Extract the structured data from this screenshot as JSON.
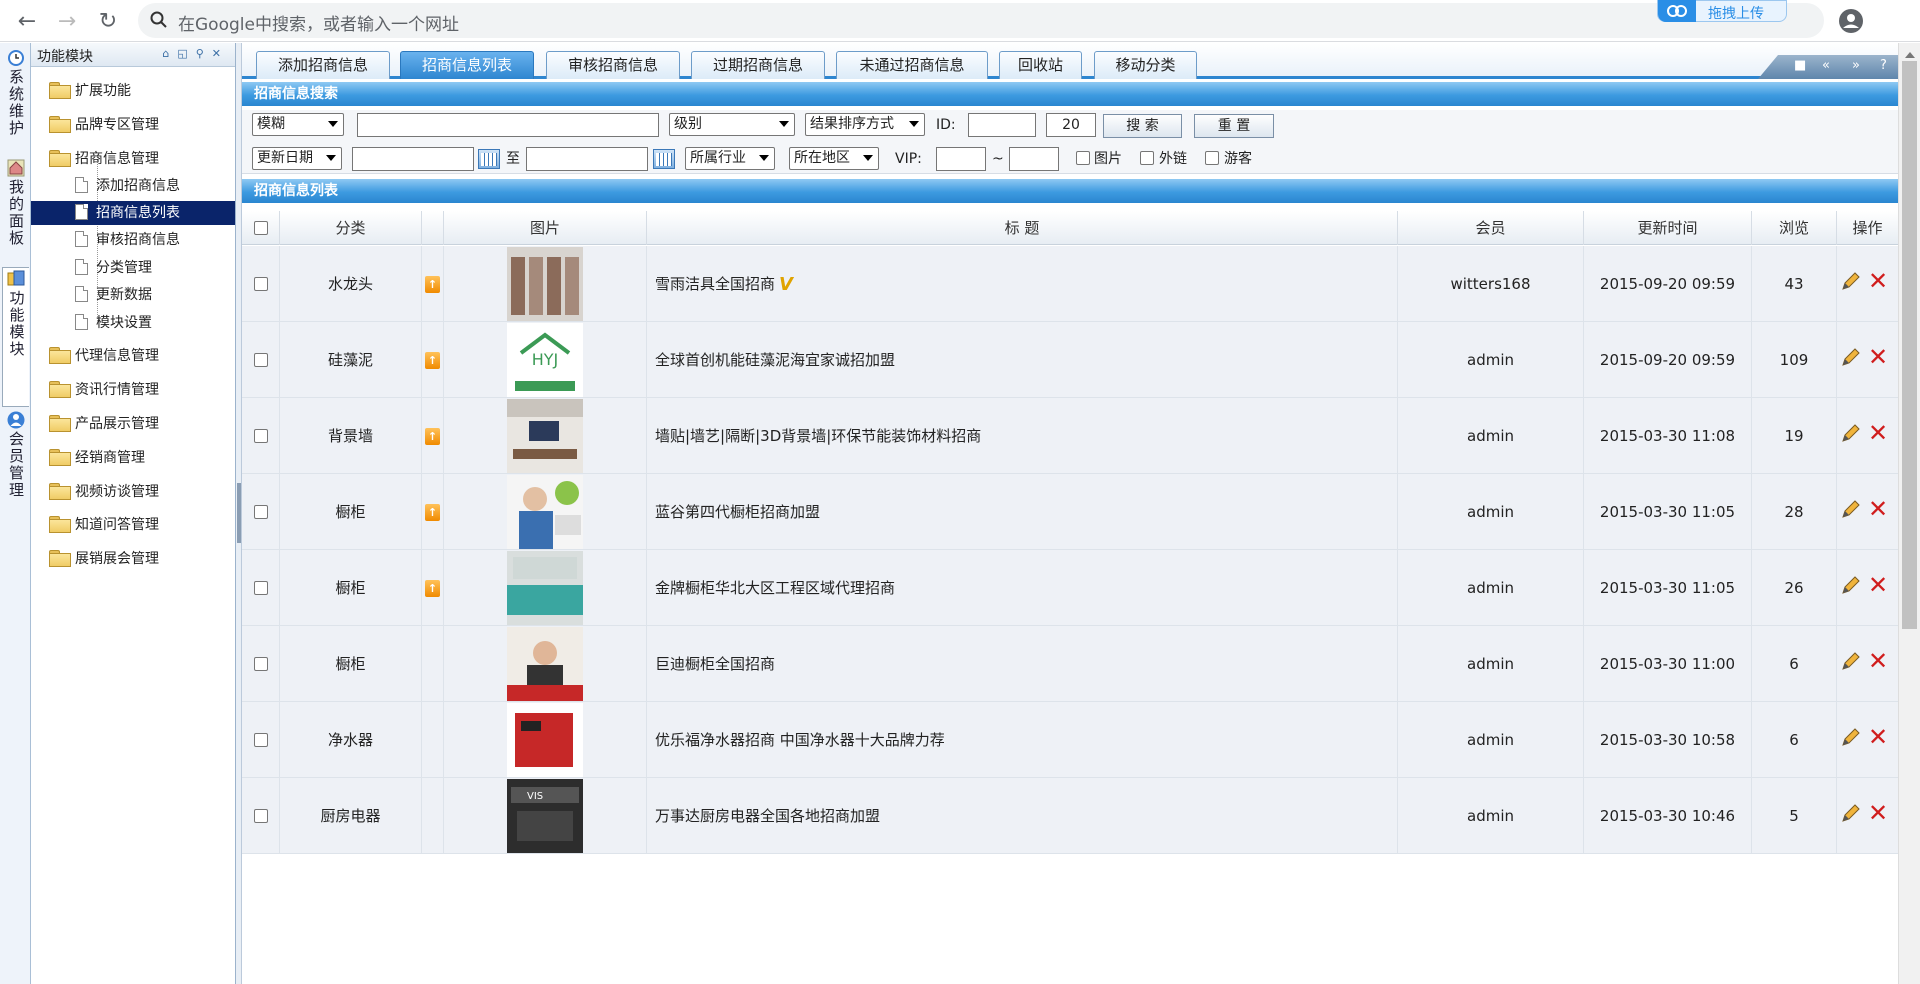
{
  "browser": {
    "omnibox_placeholder": "在Google中搜索，或者输入一个网址",
    "upload_label": "拖拽上传"
  },
  "vtabs": [
    {
      "label": "系统维护",
      "icon": "clock-icon"
    },
    {
      "label": "我的面板",
      "icon": "home-icon"
    },
    {
      "label": "功能模块",
      "icon": "module-icon"
    },
    {
      "label": "会员管理",
      "icon": "user-icon"
    }
  ],
  "tree": {
    "title": "功能模块",
    "items": [
      {
        "label": "扩展功能",
        "type": "folder"
      },
      {
        "label": "品牌专区管理",
        "type": "folder"
      },
      {
        "label": "招商信息管理",
        "type": "folder"
      },
      {
        "label": "添加招商信息",
        "type": "doc"
      },
      {
        "label": "招商信息列表",
        "type": "doc",
        "selected": true
      },
      {
        "label": "审核招商信息",
        "type": "doc"
      },
      {
        "label": "分类管理",
        "type": "doc"
      },
      {
        "label": "更新数据",
        "type": "doc"
      },
      {
        "label": "模块设置",
        "type": "doc"
      },
      {
        "label": "代理信息管理",
        "type": "folder"
      },
      {
        "label": "资讯行情管理",
        "type": "folder"
      },
      {
        "label": "产品展示管理",
        "type": "folder"
      },
      {
        "label": "经销商管理",
        "type": "folder"
      },
      {
        "label": "视频访谈管理",
        "type": "folder"
      },
      {
        "label": "知道问答管理",
        "type": "folder"
      },
      {
        "label": "展销展会管理",
        "type": "folder"
      }
    ]
  },
  "tabs": [
    {
      "label": "添加招商信息"
    },
    {
      "label": "招商信息列表",
      "active": true
    },
    {
      "label": "审核招商信息"
    },
    {
      "label": "过期招商信息"
    },
    {
      "label": "未通过招商信息"
    },
    {
      "label": "回收站"
    },
    {
      "label": "移动分类"
    }
  ],
  "search": {
    "section_title": "招商信息搜索",
    "match_mode": "模糊",
    "keyword": "",
    "level": "级别",
    "order": "结果排序方式",
    "id_label": "ID:",
    "id_value": "",
    "page_size": "20",
    "search_btn": "搜 索",
    "reset_btn": "重 置",
    "date_field": "更新日期",
    "date_from": "",
    "to_label": "至",
    "date_to": "",
    "industry": "所属行业",
    "region": "所在地区",
    "vip_label": "VIP:",
    "vip_from": "",
    "tilde": "~",
    "vip_to": "",
    "opt_image": "图片",
    "opt_link": "外链",
    "opt_guest": "游客"
  },
  "list": {
    "section_title": "招商信息列表",
    "columns": [
      "分类",
      "图片",
      "标 题",
      "会员",
      "更新时间",
      "浏览",
      "操作"
    ],
    "rows": [
      {
        "category": "水龙头",
        "title": "雪雨洁具全国招商",
        "vip": true,
        "member": "witters168",
        "updated": "2015-09-20 09:59",
        "views": "43",
        "top": true,
        "img": "faucet"
      },
      {
        "category": "硅藻泥",
        "title": "全球首创机能硅藻泥海宜家诚招加盟",
        "vip": false,
        "member": "admin",
        "updated": "2015-09-20 09:59",
        "views": "109",
        "top": true,
        "img": "logo"
      },
      {
        "category": "背景墙",
        "title": "墙贴|墙艺|隔断|3D背景墙|环保节能装饰材料招商",
        "vip": false,
        "member": "admin",
        "updated": "2015-03-30 11:08",
        "views": "19",
        "top": true,
        "img": "room"
      },
      {
        "category": "橱柜",
        "title": "蓝谷第四代橱柜招商加盟",
        "vip": false,
        "member": "admin",
        "updated": "2015-03-30 11:05",
        "views": "28",
        "top": true,
        "img": "person"
      },
      {
        "category": "橱柜",
        "title": "金牌橱柜华北大区工程区域代理招商",
        "vip": false,
        "member": "admin",
        "updated": "2015-03-30 11:05",
        "views": "26",
        "top": true,
        "img": "kitchen"
      },
      {
        "category": "橱柜",
        "title": "巨迪橱柜全国招商",
        "vip": false,
        "member": "admin",
        "updated": "2015-03-30 11:00",
        "views": "6",
        "top": false,
        "img": "poster"
      },
      {
        "category": "净水器",
        "title": "优乐福净水器招商 中国净水器十大品牌力荐",
        "vip": false,
        "member": "admin",
        "updated": "2015-03-30 10:58",
        "views": "6",
        "top": false,
        "img": "red"
      },
      {
        "category": "厨房电器",
        "title": "万事达厨房电器全国各地招商加盟",
        "vip": false,
        "member": "admin",
        "updated": "2015-03-30 10:46",
        "views": "5",
        "top": false,
        "img": "appliance"
      }
    ]
  },
  "colors": {
    "accent": "#2e86d0",
    "selected": "#0a246a",
    "delete": "#d01d1d",
    "top_badge": "#f08a00"
  }
}
